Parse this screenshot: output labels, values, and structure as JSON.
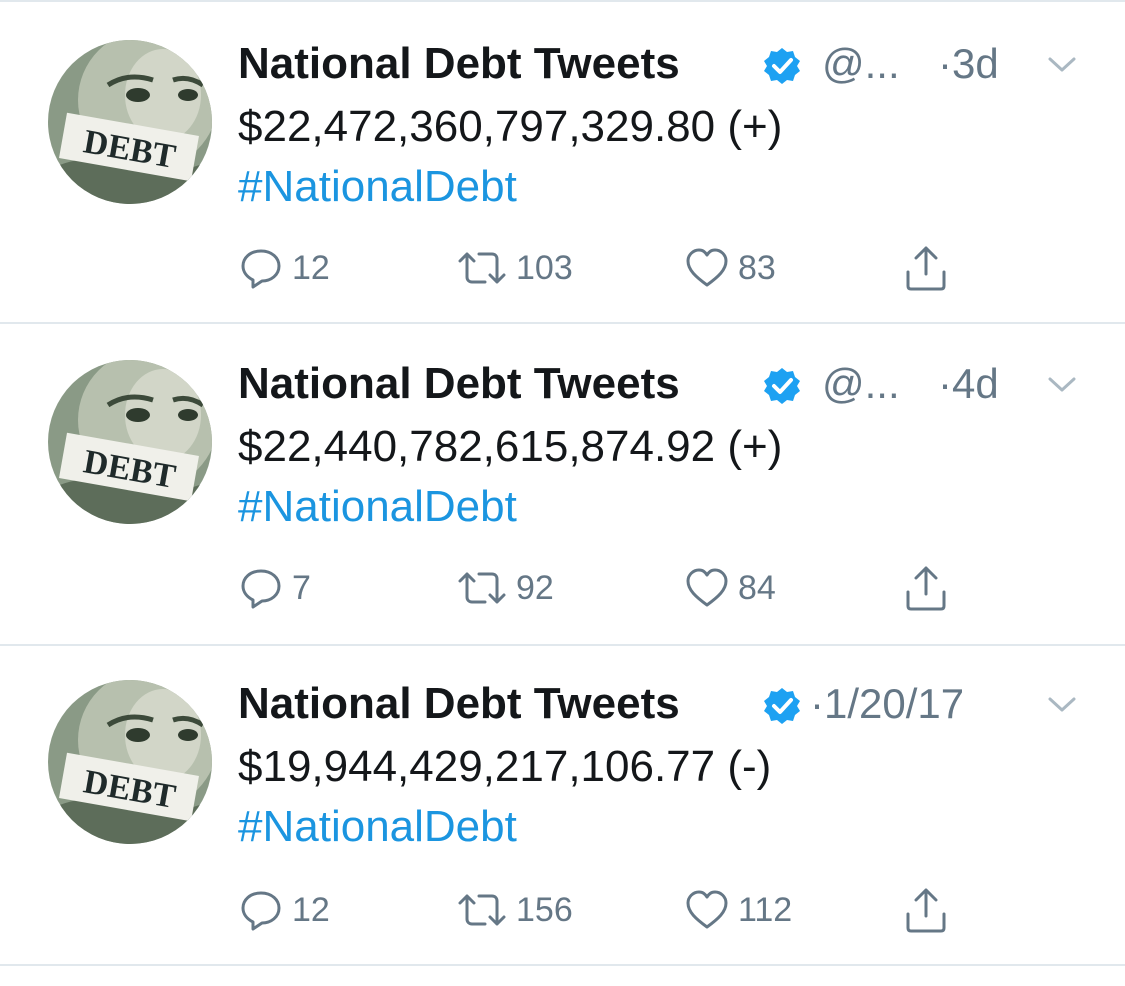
{
  "colors": {
    "text": "#14171a",
    "secondary": "#657786",
    "link": "#1b95e0",
    "verified": "#1da1f2",
    "divider": "#e1e8ed"
  },
  "avatar": {
    "label": "DEBT"
  },
  "tweets": [
    {
      "name": "National Debt Tweets",
      "handle": "@...",
      "time": "·3d",
      "text": "$22,472,360,797,329.80 (+)",
      "hashtag": "#NationalDebt",
      "replies": "12",
      "retweets": "103",
      "likes": "83",
      "icons": [
        "reply-icon",
        "retweet-icon",
        "like-icon",
        "share-icon"
      ]
    },
    {
      "name": "National Debt Tweets",
      "handle": "@...",
      "time": "·4d",
      "text": "$22,440,782,615,874.92 (+)",
      "hashtag": "#NationalDebt",
      "replies": "7",
      "retweets": "92",
      "likes": "84",
      "icons": [
        "reply-icon",
        "retweet-icon",
        "like-icon",
        "share-icon"
      ]
    },
    {
      "name": "National Debt Tweets",
      "handle": "",
      "time": "·1/20/17",
      "text": "$19,944,429,217,106.77 (-)",
      "hashtag": "#NationalDebt",
      "replies": "12",
      "retweets": "156",
      "likes": "112",
      "icons": [
        "reply-icon",
        "retweet-icon",
        "like-icon",
        "share-icon"
      ]
    }
  ]
}
